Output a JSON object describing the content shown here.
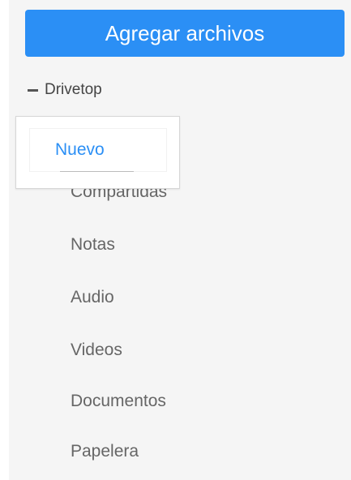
{
  "toolbar": {
    "add_files_label": "Agregar archivos"
  },
  "tree": {
    "root_label": "Drivetop",
    "root_state": "expanded",
    "items": [
      {
        "label": "Nuevo"
      },
      {
        "label": "Compartidas"
      },
      {
        "label": "Notas"
      },
      {
        "label": "Audio"
      },
      {
        "label": "Videos"
      },
      {
        "label": "Documentos"
      },
      {
        "label": "Papelera"
      }
    ]
  },
  "colors": {
    "accent": "#2b8ff5",
    "panel_bg": "#f5f5f5",
    "text": "#666666"
  },
  "icons": {
    "collapse": "minus-icon"
  }
}
